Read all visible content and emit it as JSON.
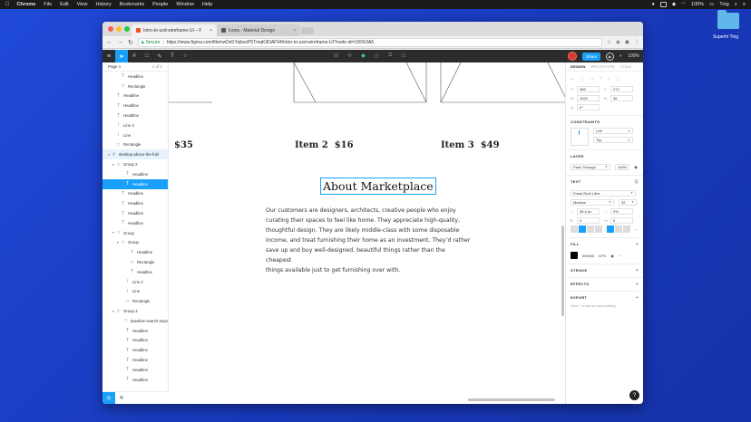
{
  "menubar": {
    "app": "Chrome",
    "items": [
      "File",
      "Edit",
      "View",
      "History",
      "Bookmarks",
      "People",
      "Window",
      "Help"
    ],
    "battery": "100%",
    "user": "Ting"
  },
  "desktop": {
    "folder_label": "Superhi Ting"
  },
  "browser": {
    "tabs": [
      {
        "title": "Intro-to-uxd-wireframe-UI – F",
        "favicon_color": "#f24e1e"
      },
      {
        "title": "Icons - Material Design",
        "favicon_color": "#555555"
      }
    ],
    "secure_label": "Secure",
    "url": "https://www.figma.com/file/nwDd1YojbszP5TmqK9DAF94/Intro-to-uxd-wireframe-UI?node-id=165%3A6"
  },
  "figma": {
    "share_label": "Share",
    "zoom": "100%",
    "layers": {
      "page_label": "Page 1",
      "page_count": "1 of 1",
      "rows": [
        {
          "icon": "T",
          "label": "Headline",
          "indent": 1
        },
        {
          "icon": "□",
          "label": "Rectangle",
          "indent": 1
        },
        {
          "icon": "T",
          "label": "Headline",
          "indent": 0
        },
        {
          "icon": "T",
          "label": "Headline",
          "indent": 0
        },
        {
          "icon": "T",
          "label": "Headline",
          "indent": 0
        },
        {
          "icon": "/",
          "label": "Line 3",
          "indent": 0
        },
        {
          "icon": "/",
          "label": "Line",
          "indent": 0
        },
        {
          "icon": "□",
          "label": "Rectangle",
          "indent": 0
        },
        {
          "icon": "#",
          "label": "desktop-above-the-fold",
          "indent": -1,
          "arrow": "▾",
          "style": "hl"
        },
        {
          "icon": "□",
          "label": "Group 2",
          "indent": 0,
          "arrow": "▾"
        },
        {
          "icon": "T",
          "label": "Headline",
          "indent": 2
        },
        {
          "icon": "T",
          "label": "Headline",
          "indent": 2,
          "style": "sel"
        },
        {
          "icon": "T",
          "label": "Headline",
          "indent": 1
        },
        {
          "icon": "T",
          "label": "Headline",
          "indent": 1
        },
        {
          "icon": "T",
          "label": "Headline",
          "indent": 1
        },
        {
          "icon": "T",
          "label": "Headline",
          "indent": 1
        },
        {
          "icon": "□",
          "label": "Group",
          "indent": 0,
          "arrow": "▾"
        },
        {
          "icon": "□",
          "label": "Group",
          "indent": 1,
          "arrow": "▾"
        },
        {
          "icon": "T",
          "label": "Headline",
          "indent": 3
        },
        {
          "icon": "□",
          "label": "Rectangle",
          "indent": 3
        },
        {
          "icon": "T",
          "label": "Headline",
          "indent": 3
        },
        {
          "icon": "/",
          "label": "Line 2",
          "indent": 2
        },
        {
          "icon": "/",
          "label": "Line",
          "indent": 2
        },
        {
          "icon": "□",
          "label": "Rectangle",
          "indent": 2
        },
        {
          "icon": "□",
          "label": "Group 3",
          "indent": 0,
          "arrow": "▾"
        },
        {
          "icon": "□",
          "label": "baseline-search-24px",
          "indent": 2
        },
        {
          "icon": "T",
          "label": "Headline",
          "indent": 2
        },
        {
          "icon": "T",
          "label": "Headline",
          "indent": 2
        },
        {
          "icon": "T",
          "label": "Headline",
          "indent": 2
        },
        {
          "icon": "T",
          "label": "Headline",
          "indent": 2
        },
        {
          "icon": "T",
          "label": "Headline",
          "indent": 2
        },
        {
          "icon": "T",
          "label": "Headline",
          "indent": 2
        }
      ]
    },
    "canvas": {
      "items": [
        {
          "name": "",
          "price": "$35"
        },
        {
          "name": "Item 2",
          "price": "$16"
        },
        {
          "name": "Item 3",
          "price": "$49"
        }
      ],
      "heading": "About Marketplace",
      "paragraph_lines": [
        "Our customers are designers, architects, creative people who enjoy",
        "curating their spaces to feel like home. They appreciate high-quality,",
        "thoughtful design. They are likely middle-class with some disposable",
        "income, and treat furnishing their home as an investment. They’d rather",
        "save up and buy well-designed, beautiful things rather than the cheapest",
        "things available just to get furnishing over with."
      ]
    },
    "props": {
      "tabs": [
        "DESIGN",
        "PROTOTYPE",
        "CODE"
      ],
      "x": "386",
      "y": "272",
      "w": "1920",
      "h": "36",
      "rotation": "0°",
      "constraints_title": "CONSTRAINTS",
      "constraint_h": "Left",
      "constraint_v": "Top",
      "layer_title": "LAYER",
      "blend": "Pass Through",
      "opacity": "100%",
      "text_title": "TEXT",
      "font": "Frank Ruhl Libre",
      "weight": "Medium",
      "size": "32",
      "line_height": "38.4 px",
      "letter_spacing": "0%",
      "para_spacing": "0",
      "indent": "0",
      "fill_title": "FILL",
      "fill_hex": "000000",
      "fill_opacity": "87%",
      "stroke_title": "STROKE",
      "effects_title": "EFFECTS",
      "export_title": "EXPORT",
      "export_hint": "Click + to add an export setting"
    }
  }
}
